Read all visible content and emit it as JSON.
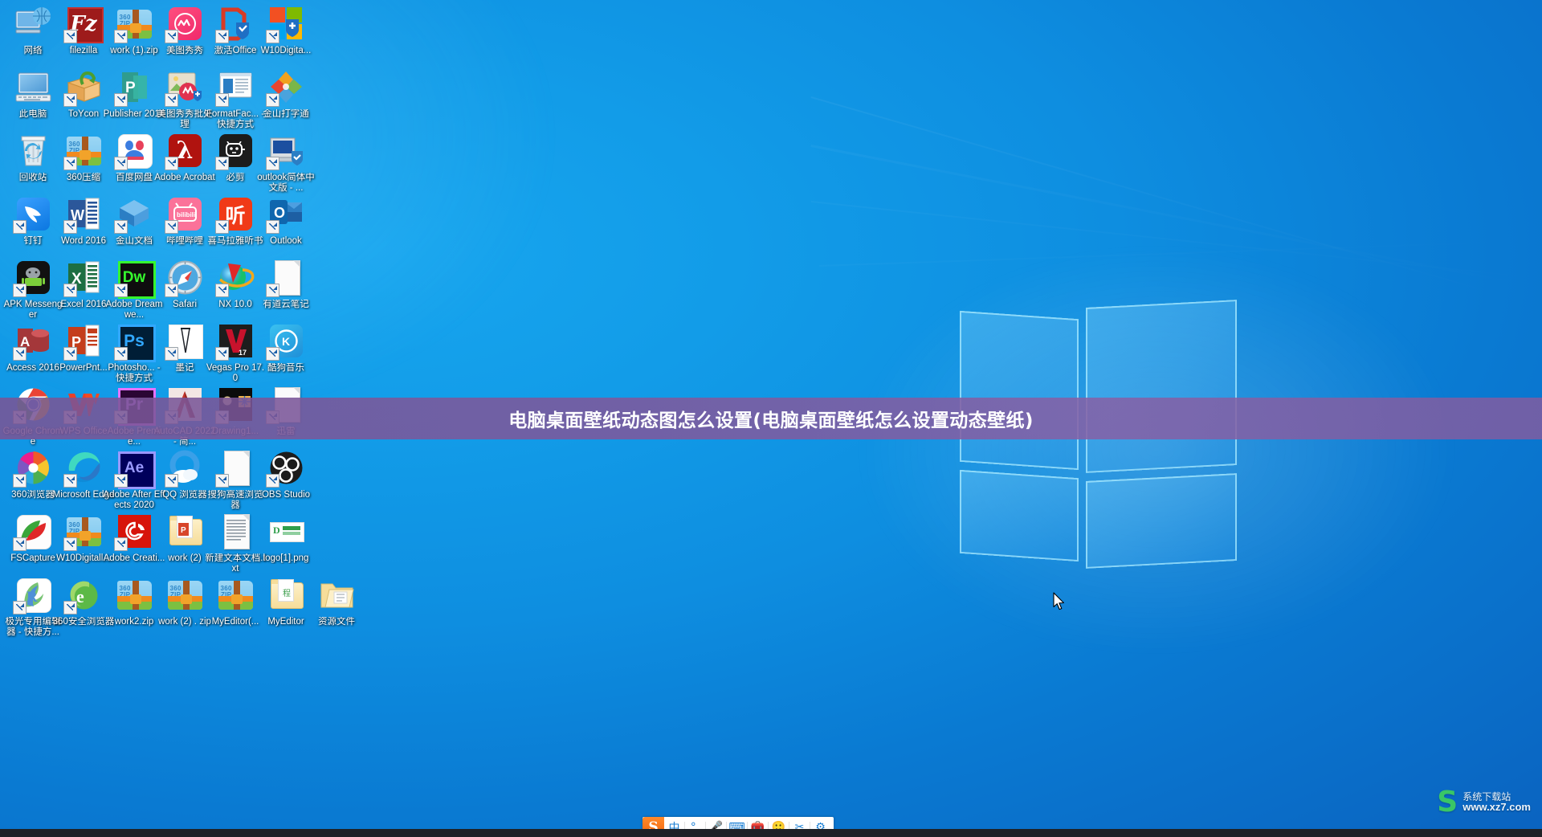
{
  "desktop": {
    "wallpaper_name": "windows-10-hero-wallpaper",
    "background_color": "#0e8ee0",
    "accent_color": "#0a63c0"
  },
  "banner": {
    "text": "电脑桌面壁纸动态图怎么设置(电脑桌面壁纸怎么设置动态壁纸)",
    "background_color": "#7e589c"
  },
  "watermark": {
    "mark": "S",
    "cn": "系统下载站",
    "en": "www.xz7.com"
  },
  "ime": {
    "logo": "S",
    "items": [
      {
        "name": "language-mode",
        "label": "中"
      },
      {
        "name": "punctuation-mode",
        "label": "°,"
      },
      {
        "name": "voice-input",
        "label": "🎤"
      },
      {
        "name": "soft-keyboard",
        "label": "⌨"
      },
      {
        "name": "toolbox",
        "label": "🧰"
      },
      {
        "name": "emoji-expression",
        "label": "🙂"
      },
      {
        "name": "screenshot-tool",
        "label": "✂"
      },
      {
        "name": "settings",
        "label": "⚙"
      }
    ]
  },
  "icons": [
    {
      "name": "网络",
      "art": "network",
      "shortcut": false,
      "col": 0,
      "row": 0
    },
    {
      "name": "filezilla",
      "art": "filezilla",
      "shortcut": true,
      "col": 1,
      "row": 0
    },
    {
      "name": "work (1).zip",
      "art": "zip360",
      "shortcut": true,
      "col": 2,
      "row": 0
    },
    {
      "name": "美图秀秀",
      "art": "meitu",
      "shortcut": true,
      "col": 3,
      "row": 0
    },
    {
      "name": "激活Office",
      "art": "office-act",
      "shortcut": true,
      "col": 4,
      "row": 0
    },
    {
      "name": "W10Digita...",
      "art": "w10digital",
      "shortcut": true,
      "col": 5,
      "row": 0
    },
    {
      "name": "此电脑",
      "art": "thispc",
      "shortcut": false,
      "col": 0,
      "row": 1
    },
    {
      "name": "ToYcon",
      "art": "toycon",
      "shortcut": true,
      "col": 1,
      "row": 1
    },
    {
      "name": "Publisher 2016",
      "art": "publisher",
      "shortcut": true,
      "col": 2,
      "row": 1
    },
    {
      "name": "美图秀秀批处理",
      "art": "meitu-batch",
      "shortcut": true,
      "col": 3,
      "row": 1
    },
    {
      "name": "FormatFac... - 快捷方式",
      "art": "formatfactory",
      "shortcut": true,
      "col": 4,
      "row": 1
    },
    {
      "name": "金山打字通",
      "art": "kingsoft-type",
      "shortcut": true,
      "col": 5,
      "row": 1
    },
    {
      "name": "回收站",
      "art": "recyclebin",
      "shortcut": false,
      "col": 0,
      "row": 2
    },
    {
      "name": "360压缩",
      "art": "zip360",
      "shortcut": true,
      "col": 1,
      "row": 2
    },
    {
      "name": "百度网盘",
      "art": "baidupan",
      "shortcut": true,
      "col": 2,
      "row": 2
    },
    {
      "name": "Adobe Acrobat",
      "art": "acrobat",
      "shortcut": true,
      "col": 3,
      "row": 2
    },
    {
      "name": "必剪",
      "art": "bijian",
      "shortcut": true,
      "col": 4,
      "row": 2
    },
    {
      "name": "outlook简体中文版 - ...",
      "art": "outlook-old",
      "shortcut": true,
      "col": 5,
      "row": 2
    },
    {
      "name": "钉钉",
      "art": "dingtalk",
      "shortcut": true,
      "col": 0,
      "row": 3
    },
    {
      "name": "Word 2016",
      "art": "word",
      "shortcut": true,
      "col": 1,
      "row": 3
    },
    {
      "name": "金山文档",
      "art": "kingsoftdoc",
      "shortcut": true,
      "col": 2,
      "row": 3
    },
    {
      "name": "哔哩哔哩",
      "art": "bilibili",
      "shortcut": true,
      "col": 3,
      "row": 3
    },
    {
      "name": "喜马拉雅听书",
      "art": "ximalaya",
      "shortcut": true,
      "col": 4,
      "row": 3
    },
    {
      "name": "Outlook",
      "art": "outlook",
      "shortcut": true,
      "col": 5,
      "row": 3
    },
    {
      "name": "APK Messenger",
      "art": "apk",
      "shortcut": true,
      "col": 0,
      "row": 4
    },
    {
      "name": "Excel 2016",
      "art": "excel",
      "shortcut": true,
      "col": 1,
      "row": 4
    },
    {
      "name": "Adobe Dreamwe...",
      "art": "dreamweaver",
      "shortcut": true,
      "col": 2,
      "row": 4
    },
    {
      "name": "Safari",
      "art": "safari",
      "shortcut": true,
      "col": 3,
      "row": 4
    },
    {
      "name": "NX 10.0",
      "art": "nx",
      "shortcut": true,
      "col": 4,
      "row": 4
    },
    {
      "name": "有道云笔记",
      "art": "doc",
      "shortcut": true,
      "col": 5,
      "row": 4
    },
    {
      "name": "Access 2016",
      "art": "access",
      "shortcut": true,
      "col": 0,
      "row": 5
    },
    {
      "name": "PowerPnt...",
      "art": "powerpoint",
      "shortcut": true,
      "col": 1,
      "row": 5
    },
    {
      "name": "Photosho... - 快捷方式",
      "art": "photoshop",
      "shortcut": true,
      "col": 2,
      "row": 5
    },
    {
      "name": "墨记",
      "art": "moji",
      "shortcut": true,
      "col": 3,
      "row": 5
    },
    {
      "name": "Vegas Pro 17.0",
      "art": "vegas",
      "shortcut": true,
      "col": 4,
      "row": 5
    },
    {
      "name": "酷狗音乐",
      "art": "kugou",
      "shortcut": true,
      "col": 5,
      "row": 5
    },
    {
      "name": "Google Chrome",
      "art": "chrome",
      "shortcut": true,
      "col": 0,
      "row": 6
    },
    {
      "name": "WPS Office",
      "art": "wps",
      "shortcut": true,
      "col": 1,
      "row": 6
    },
    {
      "name": "Adobe Premie...",
      "art": "premiere",
      "shortcut": true,
      "col": 2,
      "row": 6
    },
    {
      "name": "AutoCAD 2022 - 简...",
      "art": "autocad",
      "shortcut": true,
      "col": 3,
      "row": 6
    },
    {
      "name": "Drawing1...",
      "art": "drawing",
      "shortcut": true,
      "col": 4,
      "row": 6
    },
    {
      "name": "迅雷",
      "art": "doc",
      "shortcut": true,
      "col": 5,
      "row": 6
    },
    {
      "name": "360浏览器",
      "art": "browser360",
      "shortcut": true,
      "col": 0,
      "row": 7
    },
    {
      "name": "Microsoft Edge",
      "art": "edge",
      "shortcut": true,
      "col": 1,
      "row": 7
    },
    {
      "name": "Adobe After Effects 2020",
      "art": "aftereffects",
      "shortcut": true,
      "col": 2,
      "row": 7
    },
    {
      "name": "QQ 浏览器",
      "art": "qqbrowser",
      "shortcut": true,
      "col": 3,
      "row": 7
    },
    {
      "name": "搜狗高速浏览器",
      "art": "doc",
      "shortcut": true,
      "col": 4,
      "row": 7
    },
    {
      "name": "OBS Studio",
      "art": "obs",
      "shortcut": true,
      "col": 5,
      "row": 7
    },
    {
      "name": "FSCapture",
      "art": "fscapture",
      "shortcut": true,
      "col": 0,
      "row": 8
    },
    {
      "name": "W10Digitall...",
      "art": "zip360",
      "shortcut": true,
      "col": 1,
      "row": 8
    },
    {
      "name": "Adobe Creati...",
      "art": "creativecloud",
      "shortcut": true,
      "col": 2,
      "row": 8
    },
    {
      "name": "work (2)",
      "art": "folder-ppt",
      "shortcut": false,
      "col": 3,
      "row": 8
    },
    {
      "name": "新建文本文档.txt",
      "art": "textfile",
      "shortcut": false,
      "col": 4,
      "row": 8
    },
    {
      "name": "logo[1].png",
      "art": "logopng",
      "shortcut": false,
      "col": 5,
      "row": 8
    },
    {
      "name": "极光专用编辑器 - 快捷方...",
      "art": "jiguang",
      "shortcut": true,
      "col": 0,
      "row": 9
    },
    {
      "name": "360安全浏览器",
      "art": "browser360safe",
      "shortcut": true,
      "col": 1,
      "row": 9
    },
    {
      "name": "work2.zip",
      "art": "zip360",
      "shortcut": false,
      "col": 2,
      "row": 9
    },
    {
      "name": "work (2) . zip",
      "art": "zip360",
      "shortcut": false,
      "col": 3,
      "row": 9
    },
    {
      "name": "MyEditor(...",
      "art": "zip360",
      "shortcut": false,
      "col": 4,
      "row": 9
    },
    {
      "name": "MyEditor",
      "art": "folder",
      "shortcut": false,
      "col": 5,
      "row": 9
    },
    {
      "name": "资源文件",
      "art": "folder-open",
      "shortcut": false,
      "col": 6,
      "row": 9
    }
  ]
}
